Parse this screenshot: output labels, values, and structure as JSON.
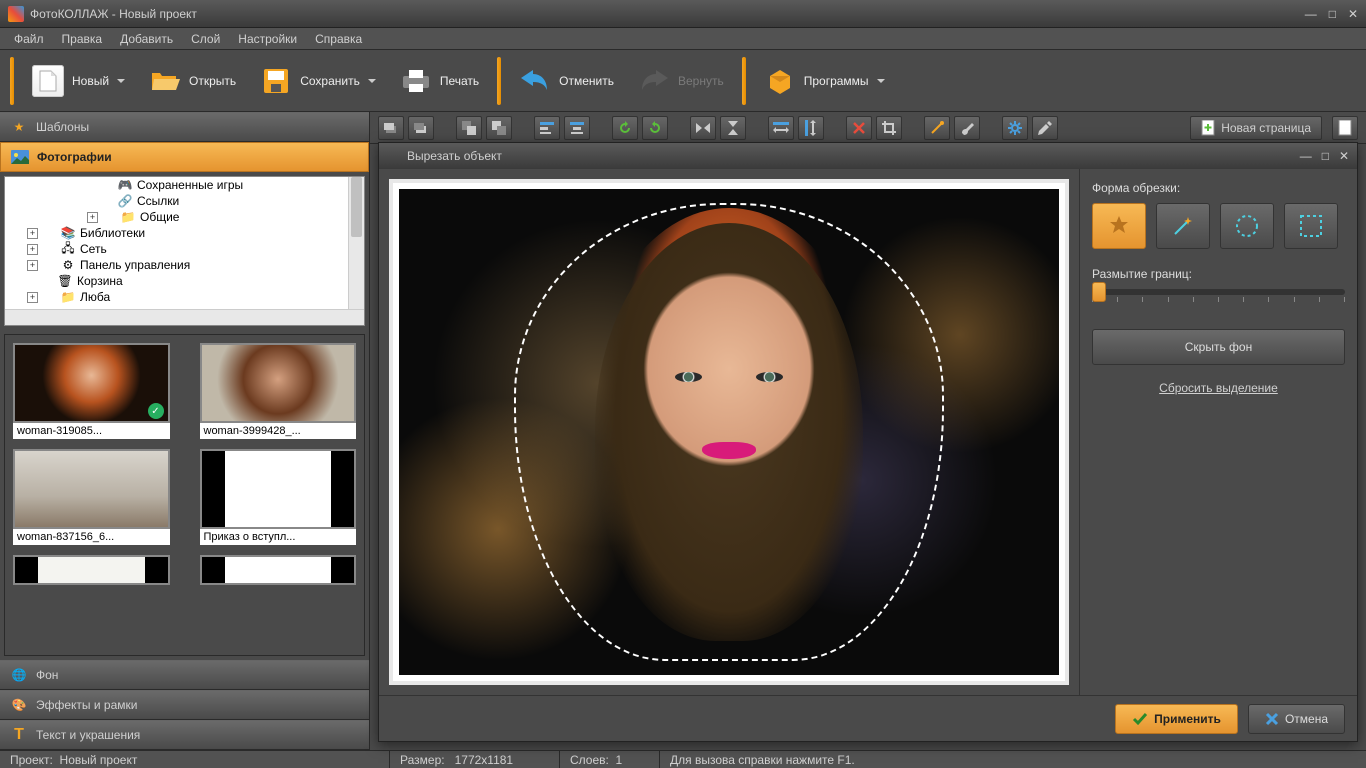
{
  "window": {
    "title": "ФотоКОЛЛАЖ - Новый проект"
  },
  "menubar": [
    "Файл",
    "Правка",
    "Добавить",
    "Слой",
    "Настройки",
    "Справка"
  ],
  "toolbar": {
    "new": "Новый",
    "open": "Открыть",
    "save": "Сохранить",
    "print": "Печать",
    "undo": "Отменить",
    "redo": "Вернуть",
    "programs": "Программы"
  },
  "sidebar": {
    "templates": "Шаблоны",
    "photos": "Фотографии",
    "background": "Фон",
    "effects": "Эффекты и рамки",
    "text": "Текст и украшения"
  },
  "tree": {
    "saved_games": "Сохраненные игры",
    "links": "Ссылки",
    "shared": "Общие",
    "libraries": "Библиотеки",
    "network": "Сеть",
    "control_panel": "Панель управления",
    "trash": "Корзина",
    "lyuba": "Люба"
  },
  "thumbs": [
    {
      "label": "woman-319085..."
    },
    {
      "label": "woman-3999428_..."
    },
    {
      "label": "woman-837156_6..."
    },
    {
      "label": "Приказ о вступл..."
    }
  ],
  "new_page": "Новая страница",
  "dialog": {
    "title": "Вырезать объект",
    "crop_shape": "Форма обрезки:",
    "blur_edges": "Размытие границ:",
    "hide_bg": "Скрыть фон",
    "reset": "Сбросить выделение",
    "apply": "Применить",
    "cancel": "Отмена"
  },
  "statusbar": {
    "project_label": "Проект:",
    "project_name": "Новый проект",
    "size_label": "Размер:",
    "size_value": "1772x1181",
    "layers_label": "Слоев:",
    "layers_value": "1",
    "help": "Для вызова справки нажмите F1."
  }
}
